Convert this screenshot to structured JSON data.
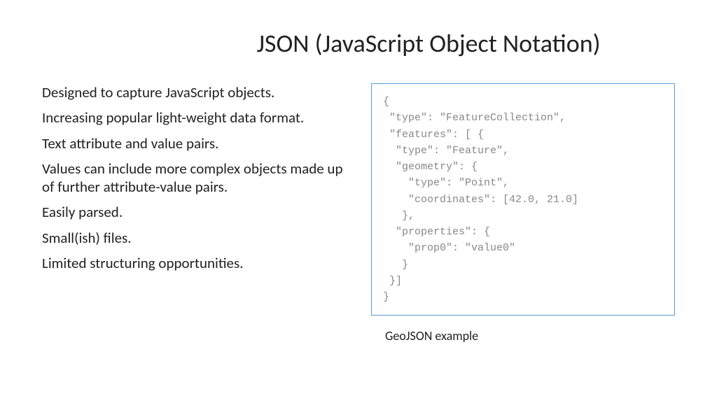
{
  "title": "JSON (JavaScript Object Notation)",
  "bullets": [
    "Designed to capture JavaScript objects.",
    "Increasing popular light-weight data format.",
    "Text attribute and value pairs.",
    "Values can include more complex objects made up of further attribute-value pairs.",
    "Easily parsed.",
    "Small(ish) files.",
    "Limited structuring opportunities."
  ],
  "code_example": "{\n \"type\": \"FeatureCollection\",\n \"features\": [ {\n  \"type\": \"Feature\",\n  \"geometry\": {\n    \"type\": \"Point\",\n    \"coordinates\": [42.0, 21.0]\n   },\n  \"properties\": {\n    \"prop0\": \"value0\"\n   }\n }]\n}",
  "caption": "GeoJSON example"
}
